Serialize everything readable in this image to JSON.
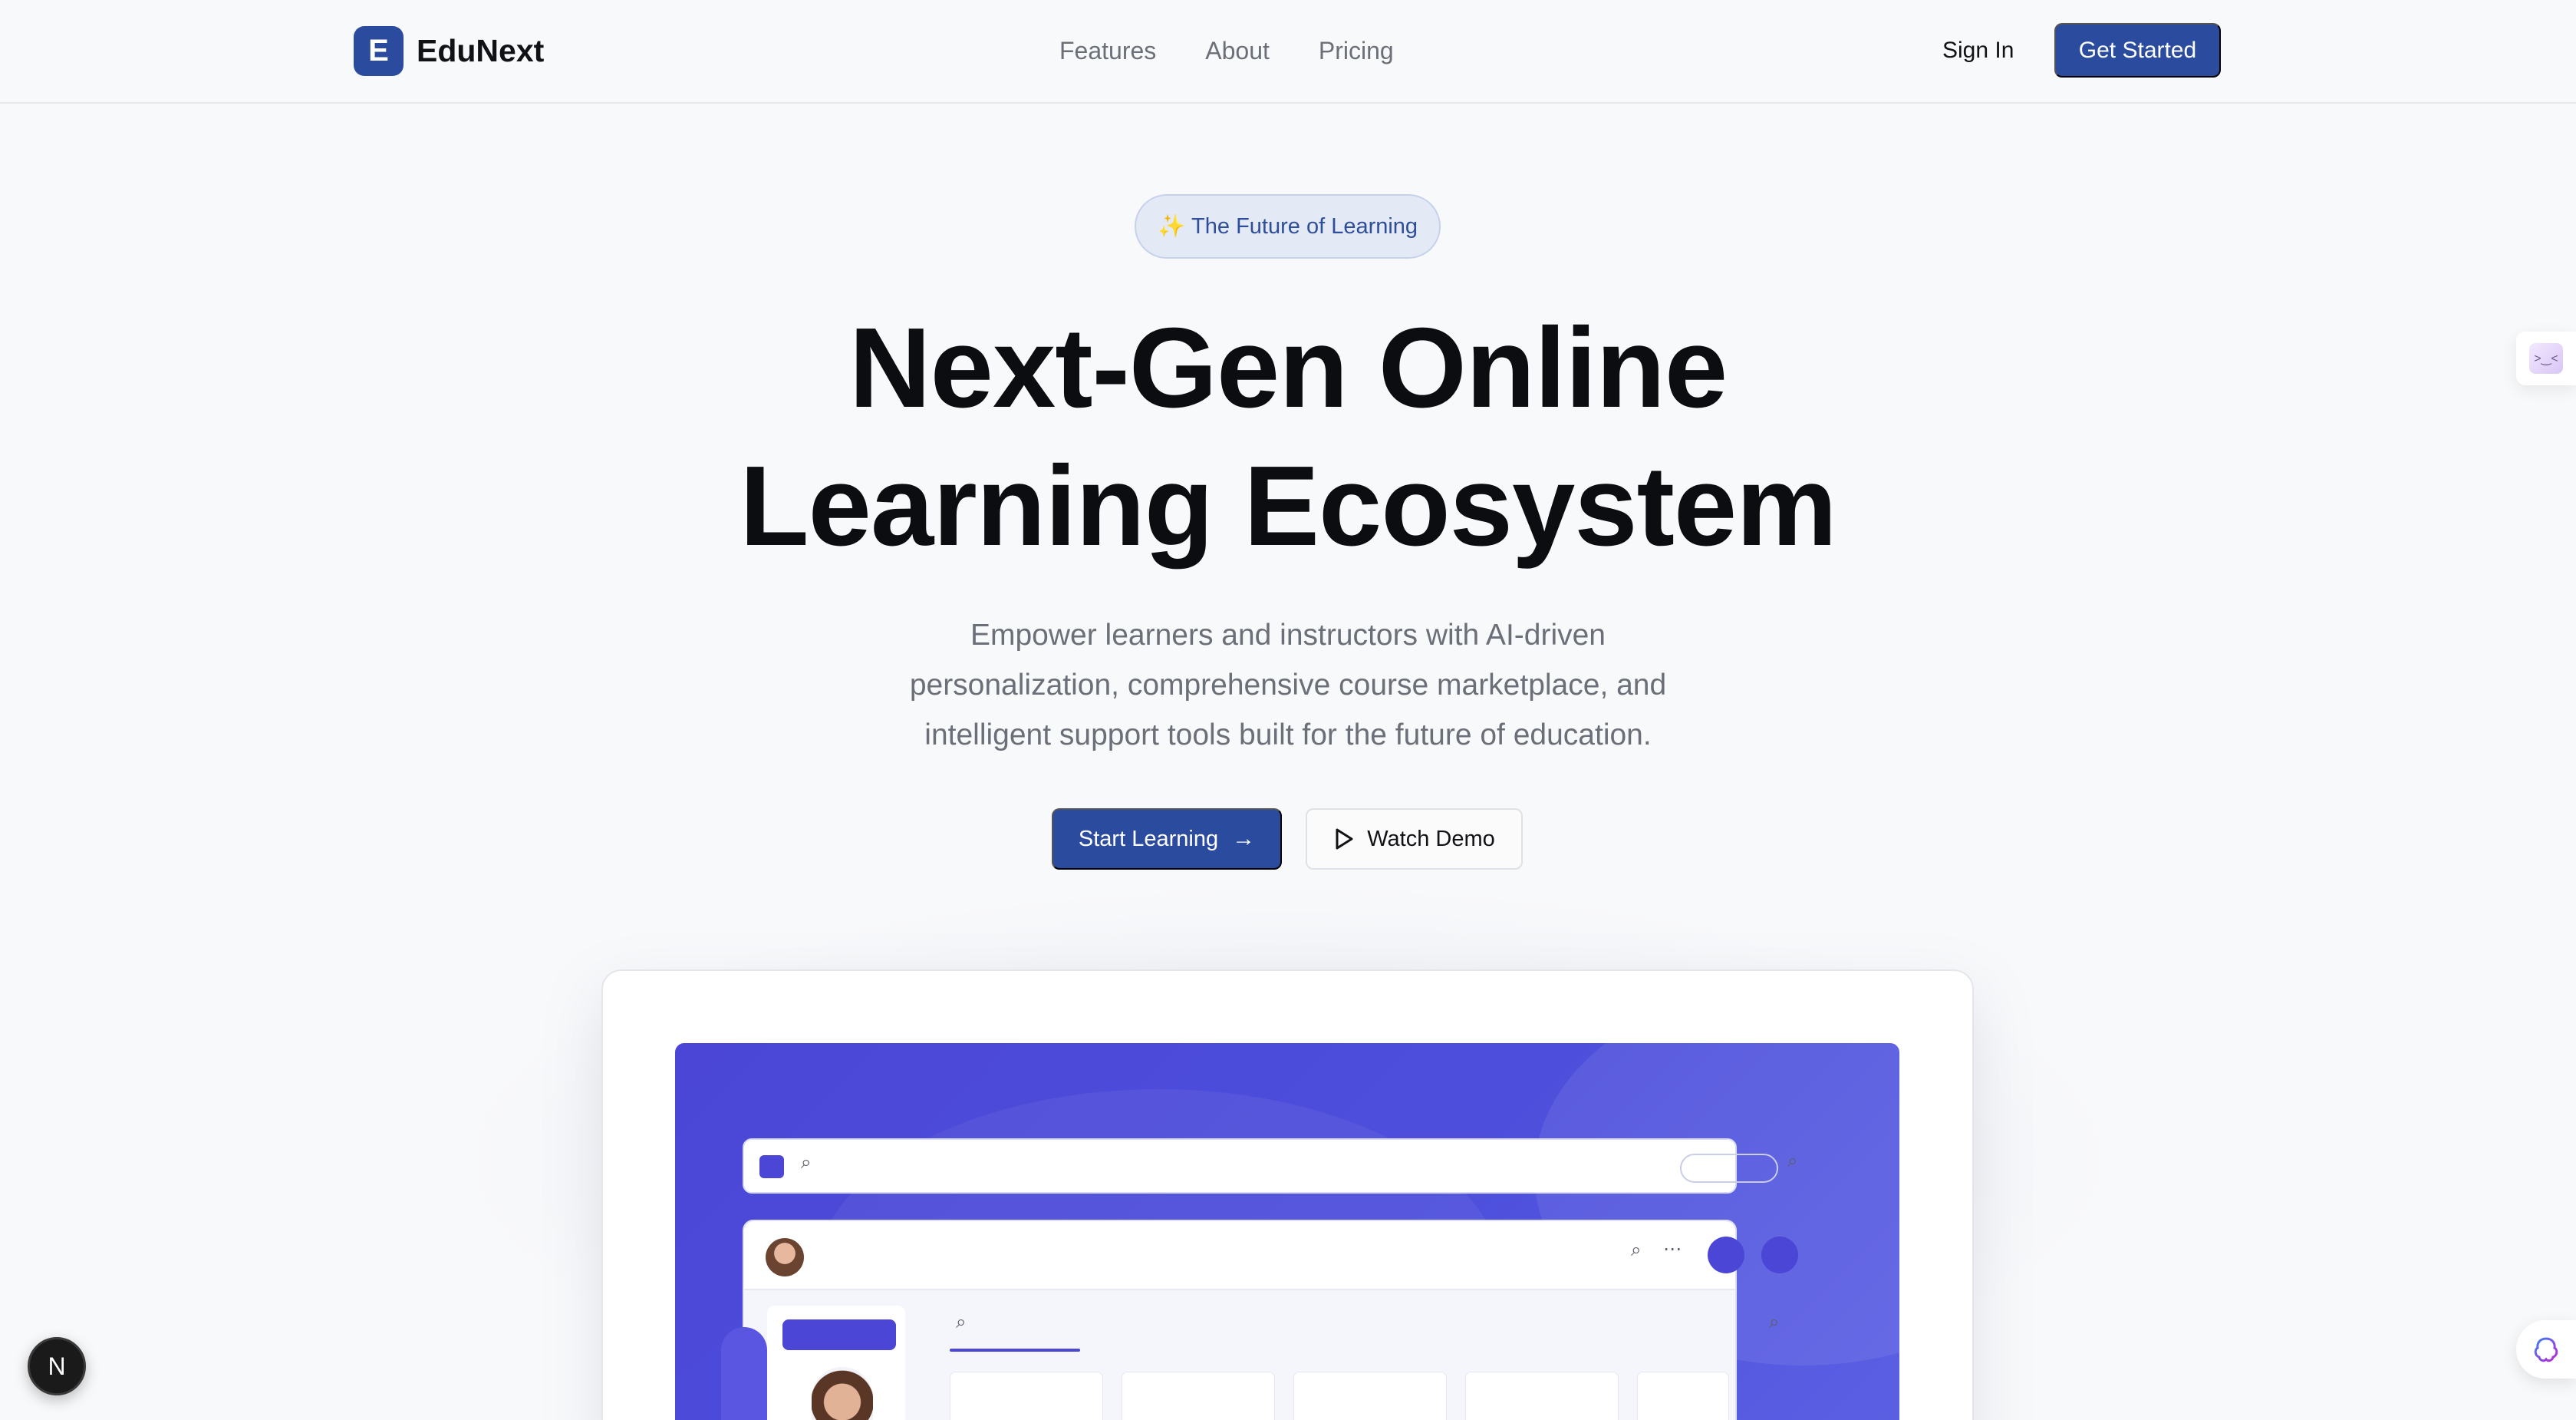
{
  "brand": {
    "logo_letter": "E",
    "name": "EduNext",
    "color": "#2b4c9e"
  },
  "nav": {
    "links": [
      "Features",
      "About",
      "Pricing"
    ],
    "sign_in": "Sign In",
    "get_started": "Get Started"
  },
  "hero": {
    "badge": "The Future of Learning",
    "badge_icon": "sparkles",
    "title_line1": "Next-Gen Online",
    "title_line2": "Learning Ecosystem",
    "subtitle": "Empower learners and instructors with AI-driven personalization, comprehensive course marketplace, and intelligent support tools built for the future of education.",
    "primary_cta": "Start Learning",
    "secondary_cta": "Watch Demo"
  },
  "preview": {
    "accent": "#4b46d6"
  },
  "dev_badge": {
    "letter": "N"
  }
}
